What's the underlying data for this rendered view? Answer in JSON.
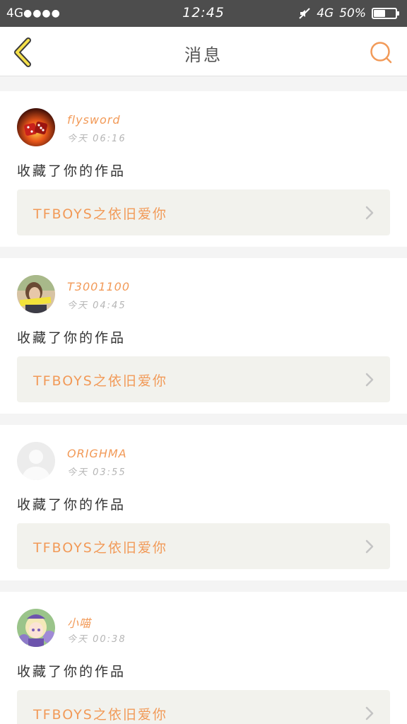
{
  "status_bar": {
    "network_left": "4G",
    "signal_dots": "●●●●",
    "time": "12:45",
    "network_right": "4G",
    "battery_text": "50%",
    "battery_level": 0.5
  },
  "nav": {
    "title": "消息",
    "back_icon": "chevron-left-icon",
    "search_icon": "search-icon",
    "accent_color": "#f29a58"
  },
  "messages": [
    {
      "username": "flysword",
      "time": "今天 06:16",
      "action": "收藏了你的作品",
      "work_title": "TFBOYS之依旧爱你",
      "avatar": "fire-dice-avatar"
    },
    {
      "username": "T3001100",
      "time": "今天 04:45",
      "action": "收藏了你的作品",
      "work_title": "TFBOYS之依旧爱你",
      "avatar": "photo-avatar"
    },
    {
      "username": "ORIGHMA",
      "time": "今天 03:55",
      "action": "收藏了你的作品",
      "work_title": "TFBOYS之依旧爱你",
      "avatar": "default-avatar"
    },
    {
      "username": "小喵",
      "time": "今天 00:38",
      "action": "收藏了你的作品",
      "work_title": "TFBOYS之依旧爱你",
      "avatar": "anime-avatar"
    }
  ]
}
